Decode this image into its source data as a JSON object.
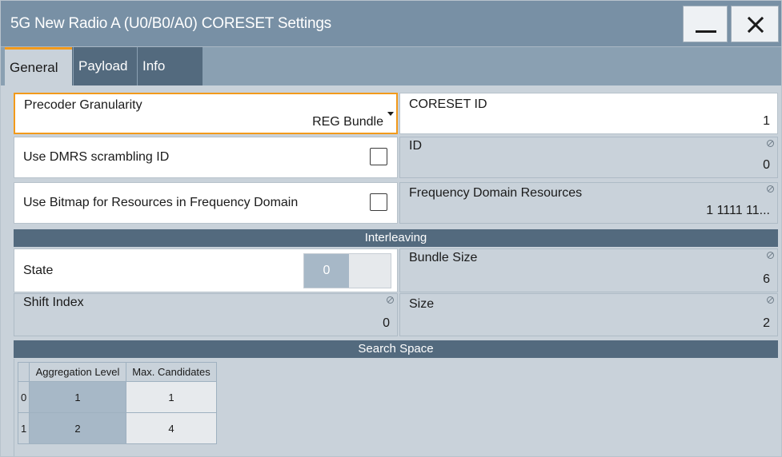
{
  "window": {
    "title": "5G New Radio A (U0/B0/A0) CORESET Settings",
    "minimize_icon": "minimize-icon",
    "close_icon": "close-icon"
  },
  "tabs": [
    {
      "label": "General",
      "active": true
    },
    {
      "label": "Payload",
      "active": false
    },
    {
      "label": "Info",
      "active": false
    }
  ],
  "general": {
    "precoder_granularity": {
      "label": "Precoder Granularity",
      "value": "REG Bundle"
    },
    "coreset_id": {
      "label": "CORESET ID",
      "value": "1"
    },
    "use_dmrs_scrambling_id": {
      "label": "Use DMRS scrambling ID",
      "checked": false
    },
    "id": {
      "label": "ID",
      "value": "0"
    },
    "use_bitmap": {
      "label": "Use Bitmap for Resources in Frequency Domain",
      "checked": false
    },
    "freq_domain_resources": {
      "label": "Frequency Domain Resources",
      "value": "1 1111 11..."
    }
  },
  "interleaving": {
    "header": "Interleaving",
    "state": {
      "label": "State",
      "value": "0"
    },
    "bundle_size": {
      "label": "Bundle Size",
      "value": "6"
    },
    "shift_index": {
      "label": "Shift Index",
      "value": "0"
    },
    "size": {
      "label": "Size",
      "value": "2"
    }
  },
  "search_space": {
    "header": "Search Space",
    "columns": [
      "Aggregation Level",
      "Max. Candidates"
    ],
    "rows": [
      {
        "index": "0",
        "aggregation_level": "1",
        "max_candidates": "1"
      },
      {
        "index": "1",
        "aggregation_level": "2",
        "max_candidates": "4"
      }
    ]
  },
  "colors": {
    "accent": "#f29a1b",
    "titlebar": "#7890a5",
    "header": "#536a7e",
    "panel": "#c9d2da"
  }
}
